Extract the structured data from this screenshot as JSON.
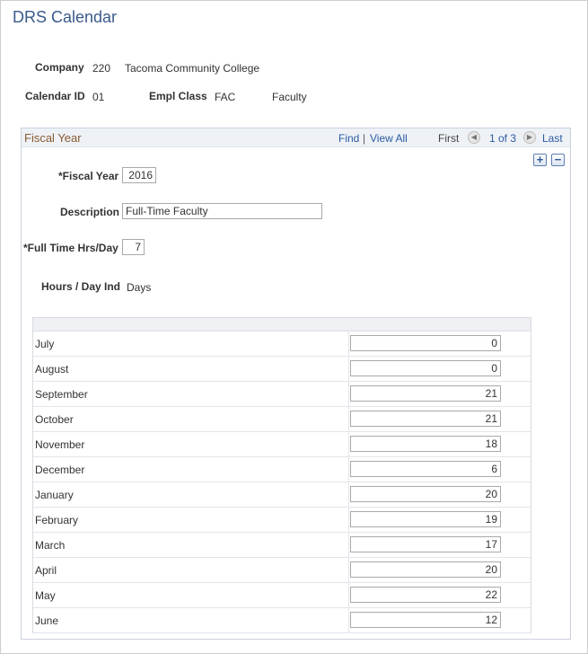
{
  "page": {
    "title": "DRS Calendar"
  },
  "header": {
    "company_label": "Company",
    "company_code": "220",
    "company_name": "Tacoma Community College",
    "calendar_id_label": "Calendar ID",
    "calendar_id": "01",
    "empl_class_label": "Empl Class",
    "empl_class_code": "FAC",
    "empl_class_name": "Faculty"
  },
  "panel": {
    "title": "Fiscal Year",
    "find": "Find",
    "separator": "|",
    "view_all": "View All",
    "first": "First",
    "counter": "1 of 3",
    "last": "Last",
    "prev_icon": "◀",
    "next_icon": "▶",
    "add_icon": "+",
    "remove_icon": "−"
  },
  "form": {
    "fiscal_year_label": "*Fiscal Year",
    "fiscal_year": "2016",
    "description_label": "Description",
    "description": "Full-Time Faculty",
    "hrs_day_label": "*Full Time Hrs/Day",
    "hrs_day": "7",
    "hours_day_ind_label": "Hours / Day Ind",
    "hours_day_ind": "Days"
  },
  "months": [
    {
      "name": "July",
      "value": "0"
    },
    {
      "name": "August",
      "value": "0"
    },
    {
      "name": "September",
      "value": "21"
    },
    {
      "name": "October",
      "value": "21"
    },
    {
      "name": "November",
      "value": "18"
    },
    {
      "name": "December",
      "value": "6"
    },
    {
      "name": "January",
      "value": "20"
    },
    {
      "name": "February",
      "value": "19"
    },
    {
      "name": "March",
      "value": "17"
    },
    {
      "name": "April",
      "value": "20"
    },
    {
      "name": "May",
      "value": "22"
    },
    {
      "name": "June",
      "value": "12"
    }
  ]
}
